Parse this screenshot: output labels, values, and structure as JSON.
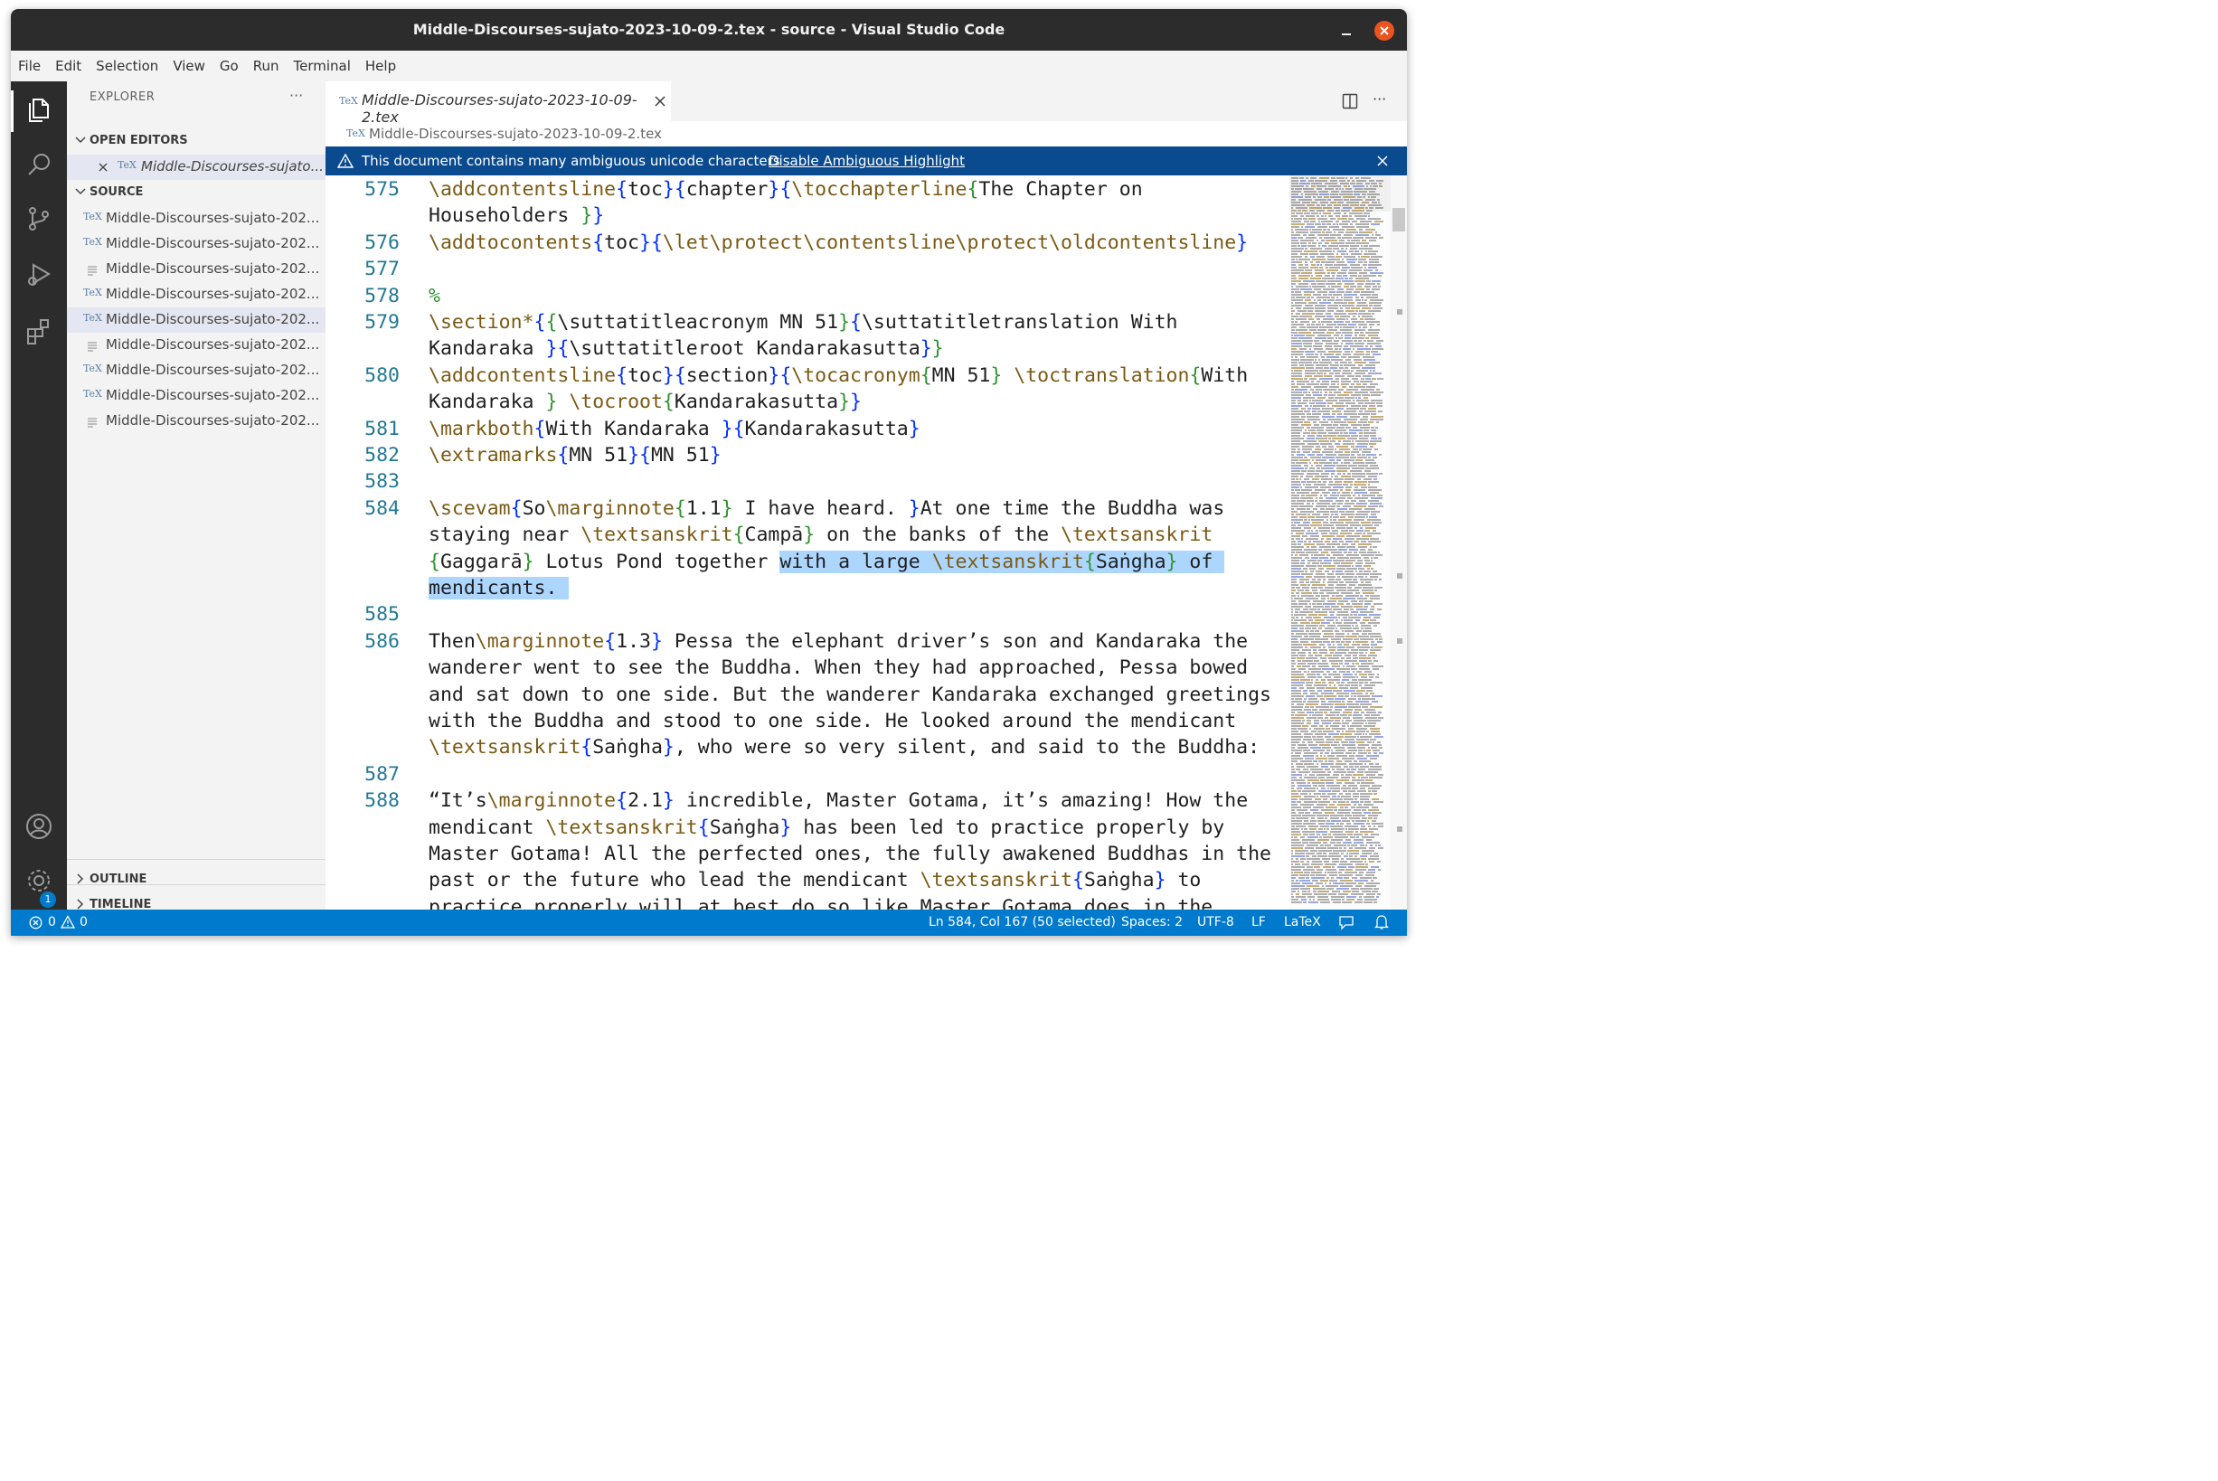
{
  "window": {
    "title": "Middle-Discourses-sujato-2023-10-09-2.tex - source - Visual Studio Code"
  },
  "menu": [
    "File",
    "Edit",
    "Selection",
    "View",
    "Go",
    "Run",
    "Terminal",
    "Help"
  ],
  "activity_bar": {
    "items": [
      "explorer-icon",
      "search-icon",
      "source-control-icon",
      "run-debug-icon",
      "extensions-icon"
    ],
    "bottom": [
      "accounts-icon",
      "manage-gear-icon"
    ],
    "settings_badge": "1"
  },
  "sidebar": {
    "title": "EXPLORER",
    "more": "···",
    "open_editors_label": "OPEN EDITORS",
    "open_editor_file": "Middle-Discourses-sujato...",
    "source_label": "SOURCE",
    "files": [
      {
        "icon": "TeX",
        "name": "Middle-Discourses-sujato-202..."
      },
      {
        "icon": "TeX",
        "name": "Middle-Discourses-sujato-202..."
      },
      {
        "icon": "lines",
        "name": "Middle-Discourses-sujato-202..."
      },
      {
        "icon": "TeX",
        "name": "Middle-Discourses-sujato-202..."
      },
      {
        "icon": "TeX",
        "name": "Middle-Discourses-sujato-202...",
        "selected": true
      },
      {
        "icon": "lines",
        "name": "Middle-Discourses-sujato-202..."
      },
      {
        "icon": "TeX",
        "name": "Middle-Discourses-sujato-202..."
      },
      {
        "icon": "TeX",
        "name": "Middle-Discourses-sujato-202..."
      },
      {
        "icon": "lines",
        "name": "Middle-Discourses-sujato-202..."
      }
    ],
    "outline_label": "OUTLINE",
    "timeline_label": "TIMELINE",
    "tex_icon": "TeX"
  },
  "editor": {
    "tab_title": "Middle-Discourses-sujato-2023-10-09-2.tex",
    "breadcrumb": "Middle-Discourses-sujato-2023-10-09-2.tex",
    "banner_text": "This document contains many ambiguous unicode characters",
    "banner_link": "Disable Ambiguous Highlight",
    "line_numbers": [
      "575",
      "576",
      "577",
      "578",
      "579",
      "580",
      "581",
      "582",
      "583",
      "584",
      "585",
      "586",
      "587",
      "588"
    ],
    "lines": [
      [
        [
          "c",
          "\\addcontentsline"
        ],
        [
          "b",
          "{"
        ],
        [
          "t",
          "toc"
        ],
        [
          "b",
          "}{"
        ],
        [
          "t",
          "chapter"
        ],
        [
          "b",
          "}{"
        ],
        [
          "c",
          "\\tocchapterline"
        ],
        [
          "g",
          "{"
        ],
        [
          "t",
          "The Chapter on"
        ]
      ],
      [
        [
          "t",
          "Householders "
        ],
        [
          "g",
          "}"
        ],
        [
          "b",
          "}"
        ]
      ],
      [
        [
          "c",
          "\\addtocontents"
        ],
        [
          "b",
          "{"
        ],
        [
          "t",
          "toc"
        ],
        [
          "b",
          "}{"
        ],
        [
          "c",
          "\\let\\protect\\contentsline\\protect\\oldcontentsline"
        ],
        [
          "b",
          "}"
        ]
      ],
      [],
      [
        [
          "g",
          "%"
        ]
      ],
      [
        [
          "c",
          "\\section*"
        ],
        [
          "b",
          "{"
        ],
        [
          "g",
          "{"
        ],
        [
          "t",
          "\\suttatitleacronym MN 51"
        ],
        [
          "g",
          "}"
        ],
        [
          "b",
          "{"
        ],
        [
          "t",
          "\\suttatitletranslation With"
        ]
      ],
      [
        [
          "t",
          "Kandaraka "
        ],
        [
          "b",
          "}"
        ],
        [
          "b",
          "{"
        ],
        [
          "t",
          "\\suttatitleroot Kandarakasutta"
        ],
        [
          "b",
          "}"
        ],
        [
          "g",
          "}"
        ]
      ],
      [
        [
          "c",
          "\\addcontentsline"
        ],
        [
          "b",
          "{"
        ],
        [
          "t",
          "toc"
        ],
        [
          "b",
          "}{"
        ],
        [
          "t",
          "section"
        ],
        [
          "b",
          "}{"
        ],
        [
          "c",
          "\\tocacronym"
        ],
        [
          "g",
          "{"
        ],
        [
          "t",
          "MN 51"
        ],
        [
          "g",
          "}"
        ],
        [
          "t",
          " "
        ],
        [
          "c",
          "\\toctranslation"
        ],
        [
          "g",
          "{"
        ],
        [
          "t",
          "With"
        ]
      ],
      [
        [
          "t",
          "Kandaraka "
        ],
        [
          "g",
          "}"
        ],
        [
          "t",
          " "
        ],
        [
          "c",
          "\\tocroot"
        ],
        [
          "g",
          "{"
        ],
        [
          "t",
          "Kandarakasutta"
        ],
        [
          "g",
          "}"
        ],
        [
          "b",
          "}"
        ]
      ],
      [
        [
          "c",
          "\\markboth"
        ],
        [
          "b",
          "{"
        ],
        [
          "t",
          "With Kandaraka "
        ],
        [
          "b",
          "}{"
        ],
        [
          "t",
          "Kandarakasutta"
        ],
        [
          "b",
          "}"
        ]
      ],
      [
        [
          "c",
          "\\extramarks"
        ],
        [
          "b",
          "{"
        ],
        [
          "t",
          "MN 51"
        ],
        [
          "b",
          "}{"
        ],
        [
          "t",
          "MN 51"
        ],
        [
          "b",
          "}"
        ]
      ],
      [],
      [
        [
          "c",
          "\\scevam"
        ],
        [
          "b",
          "{"
        ],
        [
          "t",
          "So"
        ],
        [
          "c",
          "\\marginnote"
        ],
        [
          "g",
          "{"
        ],
        [
          "t",
          "1.1"
        ],
        [
          "g",
          "}"
        ],
        [
          "t",
          " I have heard. "
        ],
        [
          "b",
          "}"
        ],
        [
          "t",
          "At one time the Buddha was"
        ]
      ],
      [
        [
          "t",
          "staying near "
        ],
        [
          "c",
          "\\textsanskrit"
        ],
        [
          "g",
          "{"
        ],
        [
          "t",
          "Campā"
        ],
        [
          "g",
          "}"
        ],
        [
          "t",
          " on the banks of the "
        ],
        [
          "c",
          "\\textsanskrit"
        ]
      ],
      [
        [
          "g",
          "{"
        ],
        [
          "t",
          "Gaggarā"
        ],
        [
          "g",
          "}"
        ],
        [
          "t",
          " Lotus Pond together "
        ],
        [
          "h",
          "with a large "
        ],
        [
          "hc",
          "\\textsanskrit"
        ],
        [
          "hg",
          "{"
        ],
        [
          "h",
          "Saṅgha"
        ],
        [
          "hg",
          "}"
        ],
        [
          "h",
          " of "
        ]
      ],
      [
        [
          "h",
          "mendicants. "
        ]
      ],
      [],
      [
        [
          "t",
          "Then"
        ],
        [
          "c",
          "\\marginnote"
        ],
        [
          "b",
          "{"
        ],
        [
          "t",
          "1.3"
        ],
        [
          "b",
          "}"
        ],
        [
          "t",
          " Pessa the elephant driver’s son and Kandaraka the"
        ]
      ],
      [
        [
          "t",
          "wanderer went to see the Buddha. When they had approached, Pessa bowed"
        ]
      ],
      [
        [
          "t",
          "and sat down to one side. But the wanderer Kandaraka exchanged greetings"
        ]
      ],
      [
        [
          "t",
          "with the Buddha and stood to one side. He looked around the mendicant"
        ]
      ],
      [
        [
          "c",
          "\\textsanskrit"
        ],
        [
          "b",
          "{"
        ],
        [
          "t",
          "Saṅgha"
        ],
        [
          "b",
          "}"
        ],
        [
          "t",
          ", who were so very silent, and said to the Buddha:"
        ]
      ],
      [],
      [
        [
          "t",
          "“It’s"
        ],
        [
          "c",
          "\\marginnote"
        ],
        [
          "b",
          "{"
        ],
        [
          "t",
          "2.1"
        ],
        [
          "b",
          "}"
        ],
        [
          "t",
          " incredible, Master Gotama, it’s amazing! How the"
        ]
      ],
      [
        [
          "t",
          "mendicant "
        ],
        [
          "c",
          "\\textsanskrit"
        ],
        [
          "b",
          "{"
        ],
        [
          "t",
          "Saṅgha"
        ],
        [
          "b",
          "}"
        ],
        [
          "t",
          " has been led to practice properly by"
        ]
      ],
      [
        [
          "t",
          "Master Gotama! All the perfected ones, the fully awakened Buddhas in the"
        ]
      ],
      [
        [
          "t",
          "past or the future who lead the mendicant "
        ],
        [
          "c",
          "\\textsanskrit"
        ],
        [
          "b",
          "{"
        ],
        [
          "t",
          "Saṅgha"
        ],
        [
          "b",
          "}"
        ],
        [
          "t",
          " to"
        ]
      ],
      [
        [
          "t",
          "practice properly will at best do so like Master Gotama does in the"
        ]
      ]
    ]
  },
  "status": {
    "errors": "0",
    "warnings": "0",
    "position": "Ln 584, Col 167 (50 selected)",
    "spaces": "Spaces: 2",
    "encoding": "UTF-8",
    "eol": "LF",
    "language": "LaTeX"
  },
  "colors": {
    "accent": "#007acc",
    "banner": "#0a4b8f",
    "close_button": "#e95420",
    "selection": "#add6ff",
    "latex_command": "#7a5a14",
    "bracket_blue": "#0431fa",
    "bracket_green": "#319331",
    "line_number": "#237893"
  }
}
